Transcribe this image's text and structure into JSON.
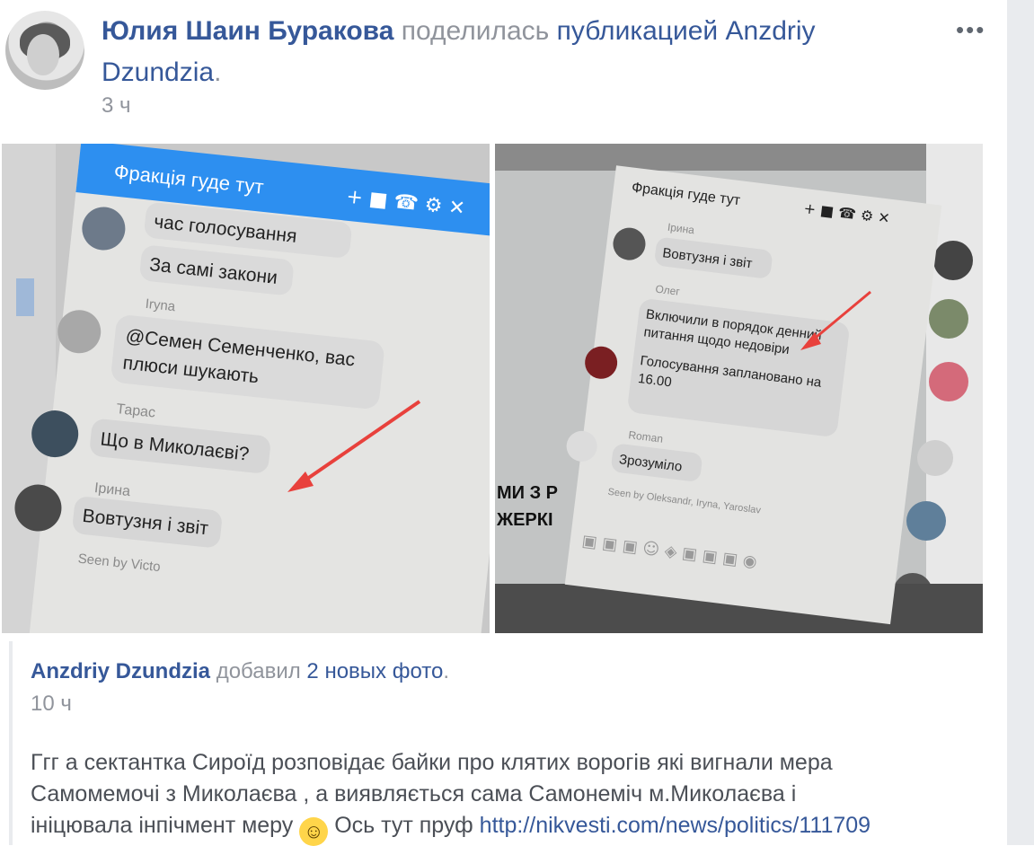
{
  "post": {
    "author": "Юлия Шаин Буракова",
    "action": "поделилась",
    "action_link": "публикацией Anzdriy Dzundzia",
    "action_end": ".",
    "time": "3 ч",
    "more": "•••"
  },
  "photo_left": {
    "chat_title": "Фракція гуде тут",
    "messages": [
      {
        "sender": "",
        "text": "час голосування"
      },
      {
        "sender": "",
        "text": "За самі закони"
      },
      {
        "sender": "Iryna",
        "text": "@Семен Семенченко, вас"
      },
      {
        "sender": "",
        "text": "плюси шукають"
      },
      {
        "sender": "Тарас",
        "text": "Що в Миколаєві?"
      },
      {
        "sender": "Ірина",
        "text": "Вовтузня і звіт"
      }
    ],
    "seen": "Seen by Victo"
  },
  "photo_right": {
    "chat_title": "Фракція гуде тут",
    "messages": [
      {
        "sender": "Ірина",
        "text": "Вовтузня і звіт"
      },
      {
        "sender": "Олег",
        "text": "Включили в порядок денний"
      },
      {
        "sender": "",
        "text": "питання щодо недовіри"
      },
      {
        "sender": "",
        "text": "Голосування заплановано на"
      },
      {
        "sender": "",
        "text": "16.00"
      },
      {
        "sender": "Roman",
        "text": "Зрозуміло"
      }
    ],
    "seen": "Seen by Oleksandr, Iryna, Yaroslav",
    "side_text_1": "МИ З Р",
    "side_text_2": "ЖЕРКІ"
  },
  "shared": {
    "author": "Anzdriy Dzundzia",
    "action": "добавил",
    "action_link": "2 новых фото",
    "action_end": ".",
    "time": "10 ч",
    "line1": "Ггг а сектантка Сироїд розповідає байки про клятих ворогів які вигнали мера",
    "line2": "Самомемочі з Миколаєва , а виявляється сама Самонеміч м.Миколаєва і",
    "line3_a": "ініцювала інпічмент меру",
    "line3_b": "Ось тут пруф",
    "url": "http://nikvesti.com/news/politics/111709"
  },
  "colors": {
    "link": "#365899",
    "meta": "#90949c",
    "text": "#4b4f56",
    "messenger": "#2d8ff0",
    "arrow": "#e8413c"
  }
}
